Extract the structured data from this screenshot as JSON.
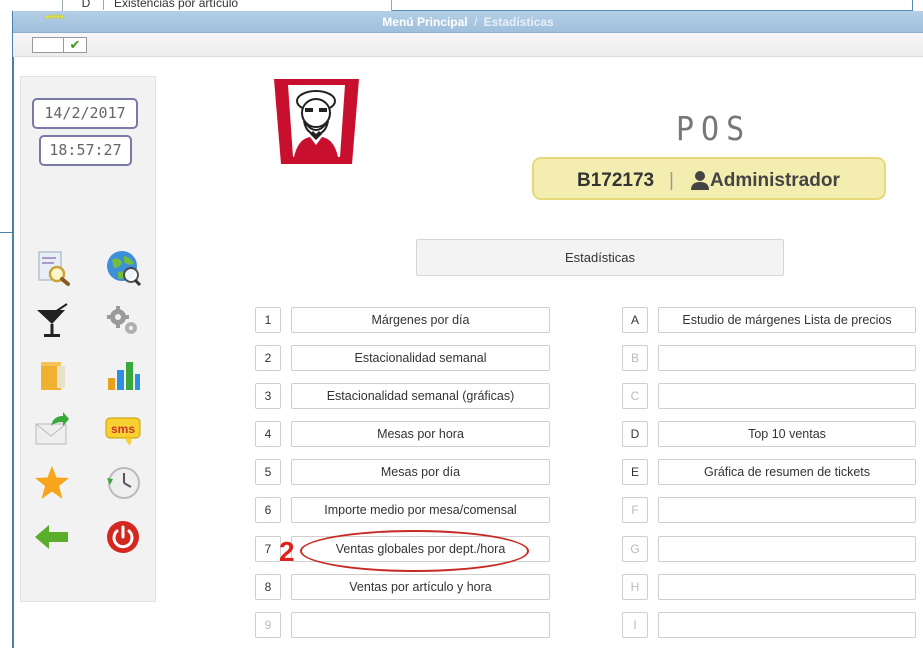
{
  "background_row": {
    "code": "D",
    "label": "Existencias por artículo"
  },
  "titlebar": {
    "stars": "*****",
    "title": "Menú Principal",
    "separator": "/",
    "subtitle": "Estadísticas"
  },
  "toolbar": {
    "check_symbol": "✔"
  },
  "clock": {
    "date": "14/2/2017",
    "time": "18:57:27"
  },
  "sidebar_icons": [
    {
      "name": "search-document-icon"
    },
    {
      "name": "globe-search-icon"
    },
    {
      "name": "cocktail-icon"
    },
    {
      "name": "gears-icon"
    },
    {
      "name": "folder-document-icon"
    },
    {
      "name": "bar-chart-icon"
    },
    {
      "name": "mail-send-icon"
    },
    {
      "name": "sms-icon",
      "text": "sms"
    },
    {
      "name": "star-icon"
    },
    {
      "name": "history-clock-icon"
    },
    {
      "name": "back-arrow-icon"
    },
    {
      "name": "power-icon"
    }
  ],
  "header": {
    "pos_label": "POS",
    "store_code": "B172173",
    "separator": "|",
    "user_name": "Administrador"
  },
  "section_title": "Estadísticas",
  "left_options": [
    {
      "key": "1",
      "label": "Márgenes por día"
    },
    {
      "key": "2",
      "label": "Estacionalidad semanal"
    },
    {
      "key": "3",
      "label": "Estacionalidad semanal (gráficas)"
    },
    {
      "key": "4",
      "label": "Mesas por hora"
    },
    {
      "key": "5",
      "label": "Mesas por día"
    },
    {
      "key": "6",
      "label": "Importe medio por mesa/comensal"
    },
    {
      "key": "7",
      "label": "Ventas globales por dept./hora"
    },
    {
      "key": "8",
      "label": "Ventas por artículo y hora"
    },
    {
      "key": "9",
      "label": ""
    }
  ],
  "right_options": [
    {
      "key": "A",
      "label": "Estudio de márgenes Lista de precios"
    },
    {
      "key": "B",
      "label": ""
    },
    {
      "key": "C",
      "label": ""
    },
    {
      "key": "D",
      "label": "Top 10 ventas"
    },
    {
      "key": "E",
      "label": "Gráfica de resumen de tickets"
    },
    {
      "key": "F",
      "label": ""
    },
    {
      "key": "G",
      "label": ""
    },
    {
      "key": "H",
      "label": ""
    },
    {
      "key": "I",
      "label": ""
    }
  ],
  "annotation": {
    "number": "2"
  },
  "colors": {
    "titlebar": "#a9c7e2",
    "accent_red": "#e0201b",
    "user_bar": "#f3eeaf"
  }
}
